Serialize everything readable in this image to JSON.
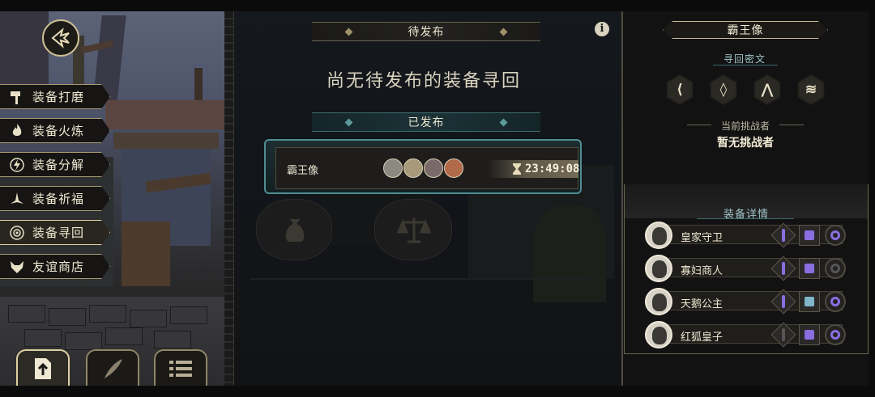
{
  "menu": {
    "back_icon": "back-arrow-icon",
    "items": [
      {
        "label": "装备打磨",
        "icon": "hammer-icon"
      },
      {
        "label": "装备火炼",
        "icon": "flame-icon"
      },
      {
        "label": "装备分解",
        "icon": "lightning-icon"
      },
      {
        "label": "装备祈福",
        "icon": "blessing-icon"
      },
      {
        "label": "装备寻回",
        "icon": "target-icon",
        "active": true
      },
      {
        "label": "友谊商店",
        "icon": "fox-icon"
      }
    ],
    "bottom_buttons": [
      {
        "icon": "upload-doc-icon",
        "active": true
      },
      {
        "icon": "feather-icon",
        "active": false
      },
      {
        "icon": "list-icon",
        "active": false
      }
    ]
  },
  "center": {
    "pending_title": "待发布",
    "pending_empty": "尚无待发布的装备寻回",
    "published_title": "已发布",
    "published_card": {
      "name": "霸王像",
      "timer": "23:49:08",
      "timer_icon": "hourglass-icon",
      "avatar_count": 4
    },
    "info_label": "i",
    "faded_icons": [
      "money-bag-icon",
      "scales-icon"
    ]
  },
  "right_panel": {
    "title": "霸王像",
    "cipher_heading": "寻回密文",
    "cipher_symbols": [
      "⟨",
      "◊",
      "⋀",
      "≋"
    ],
    "challenger_label": "当前挑战者",
    "challenger_value": "暂无挑战者",
    "details_heading": "装备详情",
    "heroes": [
      {
        "name": "皇家守卫",
        "weapon": "#8a6ee0",
        "armor": "#8a6ee0",
        "ring": "#8a6ee0"
      },
      {
        "name": "寡妇商人",
        "weapon": "#8a6ee0",
        "armor": "#8a6ee0",
        "ring": "#555"
      },
      {
        "name": "天鹅公主",
        "weapon": "#8a6ee0",
        "armor": "#7fb6c8",
        "ring": "#8a6ee0"
      },
      {
        "name": "红狐皇子",
        "weapon": "#555",
        "armor": "#8a6ee0",
        "ring": "#8a6ee0"
      }
    ]
  },
  "colors": {
    "accent_gold": "#cdbf94",
    "accent_teal": "#4f8e92",
    "rarity_purple": "#8a6ee0"
  }
}
